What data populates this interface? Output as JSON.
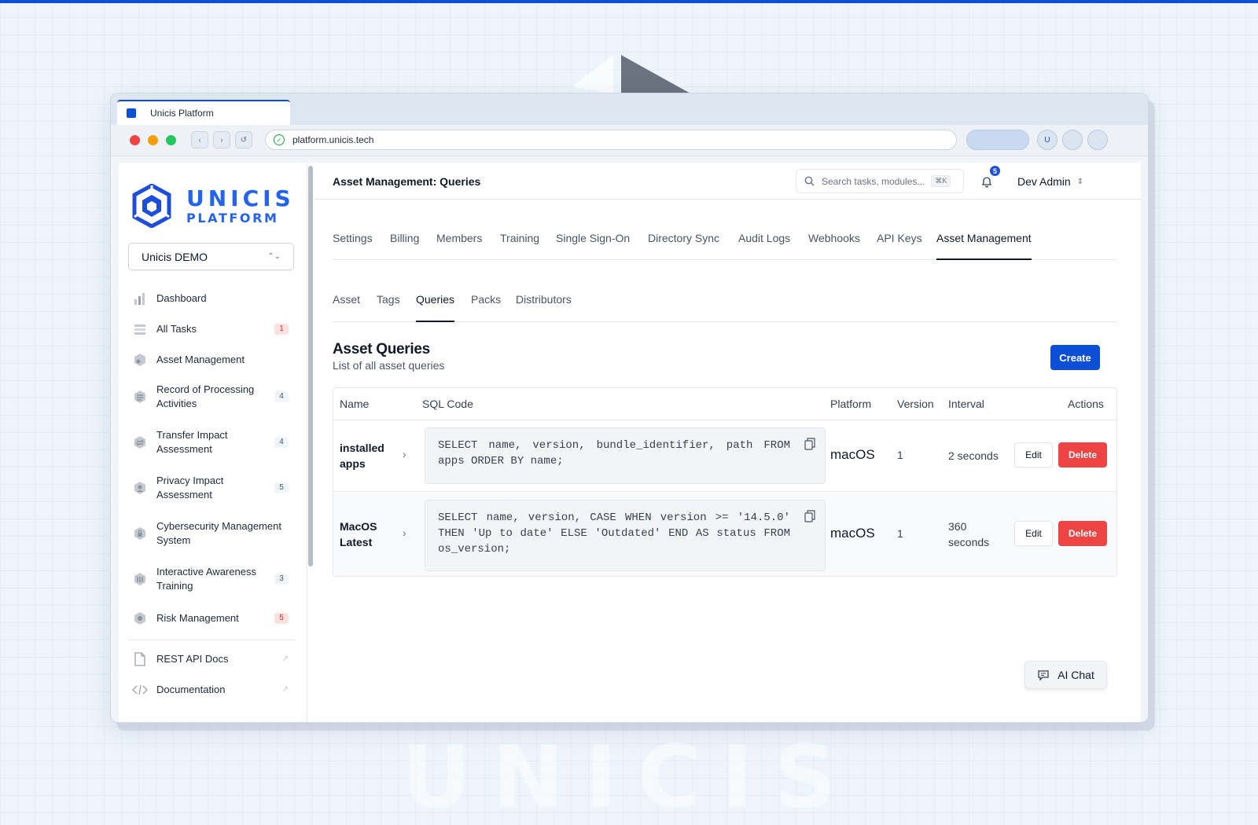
{
  "browser": {
    "tab_title": "Unicis Platform",
    "url": "platform.unicis.tech",
    "avatar_initial": "U",
    "nav": {
      "back": "‹",
      "forward": "›",
      "reload": "↺"
    },
    "traffic_colors": [
      "#ef4444",
      "#f59e0b",
      "#22c55e"
    ]
  },
  "sidebar": {
    "logo_line1": "UNICIS",
    "logo_line2": "PLATFORM",
    "org_select": "Unicis DEMO",
    "items": [
      {
        "label": "Dashboard",
        "badge": "",
        "icon": "bar-chart-icon"
      },
      {
        "label": "All Tasks",
        "badge": "1",
        "badge_color": "red",
        "icon": "list-icon"
      },
      {
        "label": "Asset Management",
        "badge": "",
        "icon": "asset-icon"
      },
      {
        "label": "Record of Processing Activities",
        "badge": "4",
        "icon": "records-icon"
      },
      {
        "label": "Transfer Impact Assessment",
        "badge": "4",
        "icon": "transfer-icon"
      },
      {
        "label": "Privacy Impact Assessment",
        "badge": "5",
        "icon": "privacy-icon"
      },
      {
        "label": "Cybersecurity Management System",
        "badge": "",
        "icon": "shield-icon"
      },
      {
        "label": "Interactive Awareness Training",
        "badge": "3",
        "icon": "training-icon"
      },
      {
        "label": "Risk Management",
        "badge": "5",
        "badge_color": "red",
        "icon": "risk-icon"
      }
    ],
    "links": [
      {
        "label": "REST API Docs",
        "icon": "document-icon"
      },
      {
        "label": "Documentation",
        "icon": "code-icon"
      }
    ]
  },
  "header": {
    "title": "Asset Management: Queries",
    "search_placeholder": "Search tasks, modules...",
    "search_shortcut": "⌘K",
    "notification_count": "5",
    "user_name": "Dev Admin"
  },
  "settings_tabs": [
    "Settings",
    "Billing",
    "Members",
    "Training",
    "Single Sign-On",
    "Directory Sync",
    "Audit Logs",
    "Webhooks",
    "API Keys",
    "Asset Management"
  ],
  "settings_active": "Asset Management",
  "asset_tabs": [
    "Asset",
    "Tags",
    "Queries",
    "Packs",
    "Distributors"
  ],
  "asset_active": "Queries",
  "section": {
    "title": "Asset Queries",
    "subtitle": "List of all asset queries",
    "create_label": "Create"
  },
  "table": {
    "columns": [
      "Name",
      "SQL Code",
      "Platform",
      "Version",
      "Interval",
      "Actions"
    ],
    "rows": [
      {
        "name": "installed apps",
        "sql": "SELECT name, version, bundle_identifier, path FROM apps ORDER BY name;",
        "platform": "macOS",
        "version": "1",
        "interval": "2 seconds",
        "edit": "Edit",
        "delete": "Delete"
      },
      {
        "name": "MacOS Latest",
        "sql": "SELECT name, version, CASE WHEN version >= '14.5.0' THEN 'Up to date' ELSE 'Outdated' END AS status FROM os_version;",
        "platform": "macOS",
        "version": "1",
        "interval": "360 seconds",
        "edit": "Edit",
        "delete": "Delete"
      }
    ]
  },
  "ai_chat_label": "AI Chat",
  "watermark": "UNICIS",
  "colors": {
    "brand": "#0b4fd6",
    "danger": "#ef4444",
    "badge_red": "#dc2626"
  }
}
